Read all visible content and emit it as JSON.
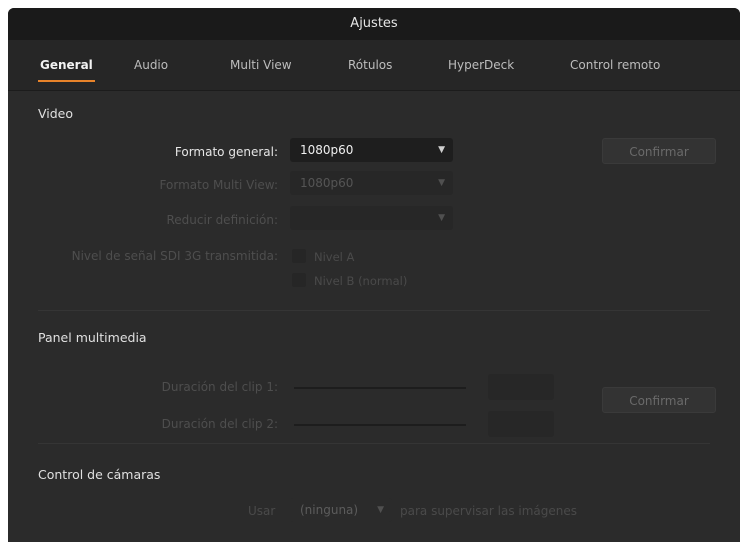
{
  "window": {
    "title": "Ajustes"
  },
  "tabs": [
    {
      "label": "General",
      "active": true
    },
    {
      "label": "Audio",
      "active": false
    },
    {
      "label": "Multi View",
      "active": false
    },
    {
      "label": "Rótulos",
      "active": false
    },
    {
      "label": "HyperDeck",
      "active": false
    },
    {
      "label": "Control remoto",
      "active": false
    }
  ],
  "video": {
    "section_title": "Video",
    "format_label": "Formato general:",
    "format_value": "1080p60",
    "multiview_label": "Formato Multi View:",
    "multiview_value": "1080p60",
    "downconvert_label": "Reducir definición:",
    "downconvert_value": "",
    "sdi_label": "Nivel de señal SDI 3G transmitida:",
    "level_a_label": "Nivel A",
    "level_b_label": "Nivel B (normal)",
    "confirm_label": "Confirmar"
  },
  "media": {
    "section_title": "Panel multimedia",
    "clip1_label": "Duración del clip 1:",
    "clip2_label": "Duración del clip 2:",
    "confirm_label": "Confirmar"
  },
  "camera": {
    "section_title": "Control de cámaras",
    "use_label": "Usar",
    "use_value": "(ninguna)",
    "suffix_label": "para supervisar las imágenes"
  },
  "colors": {
    "accent": "#e8832a",
    "background": "#2b2b2b"
  }
}
